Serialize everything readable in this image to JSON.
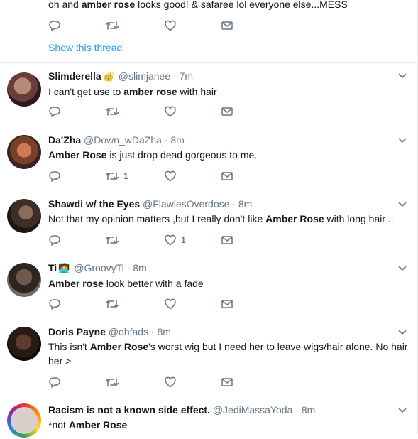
{
  "first_tweet": {
    "text_parts": [
      "oh and ",
      "amber rose",
      " looks good! & safaree lol everyone else...MESS"
    ],
    "show_thread": "Show this thread"
  },
  "tweets": [
    {
      "name": "Slimderella",
      "emoji": "👑",
      "handle": "@slimjanee",
      "time": "· 7m",
      "text_parts": [
        "I can't get use to ",
        "amber rose",
        " with hair"
      ],
      "retweets": "",
      "likes": ""
    },
    {
      "name": "Da'Zha",
      "emoji": "",
      "handle": "@Down_wDaZha",
      "time": "· 8m",
      "text_parts": [
        "",
        "Amber Rose",
        " is just drop dead gorgeous to me."
      ],
      "retweets": "1",
      "likes": ""
    },
    {
      "name": "Shawdi w/ the Eyes",
      "emoji": "",
      "handle": "@FlawlesOverdose",
      "time": "· 8m",
      "text_parts": [
        "Not that my opinion matters ,but I really don't like ",
        "Amber Rose",
        " with long hair .."
      ],
      "retweets": "",
      "likes": "1"
    },
    {
      "name": "Ti",
      "emoji": "🧑‍💻",
      "handle": "@GroovyTi",
      "time": "· 8m",
      "text_parts": [
        "",
        "Amber rose",
        " look better with a fade"
      ],
      "retweets": "",
      "likes": ""
    },
    {
      "name": "Doris Payne",
      "emoji": "",
      "handle": "@ohfads",
      "time": "· 8m",
      "text_parts": [
        "This isn't ",
        "Amber Rose",
        "'s worst wig but I need her to leave wigs/hair alone. No hair her >"
      ],
      "retweets": "",
      "likes": ""
    },
    {
      "name": "Racism is not a known side effect.",
      "emoji": "",
      "handle": "@JediMassaYoda",
      "time": "· 8m",
      "text_parts": [
        "*not ",
        "Amber Rose",
        ""
      ],
      "retweets": "",
      "likes": ""
    }
  ],
  "icons": {
    "reply": "reply-icon",
    "retweet": "retweet-icon",
    "like": "heart-icon",
    "dm": "envelope-icon",
    "caret": "chevron-down-icon"
  },
  "colors": {
    "link": "#1da1f2",
    "secondary_text": "#657786",
    "divider": "#e6ecf0"
  }
}
